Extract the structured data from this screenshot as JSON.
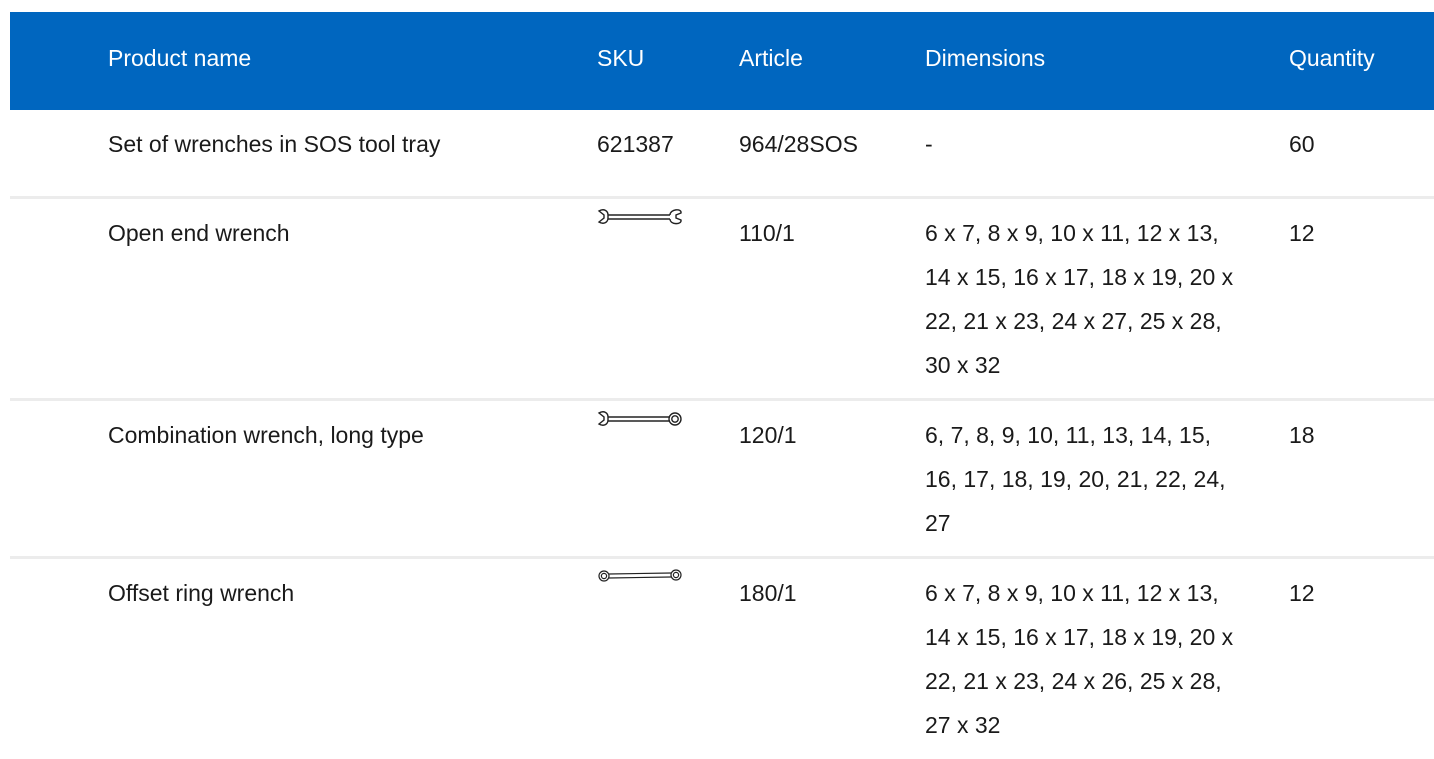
{
  "table": {
    "headers": {
      "name": "Product name",
      "sku": "SKU",
      "article": "Article",
      "dimensions": "Dimensions",
      "quantity": "Quantity"
    },
    "rows": [
      {
        "name": "Set of wrenches in SOS tool tray",
        "sku": "621387",
        "article": "964/28SOS",
        "dimensions": "-",
        "quantity": "60"
      },
      {
        "name": "Open end wrench",
        "sku_icon": "open-end-wrench-icon",
        "article": "110/1",
        "dimensions": "6 x 7, 8 x 9, 10 x 11, 12 x 13, 14 x 15, 16 x 17, 18 x 19, 20 x 22, 21 x 23, 24 x 27, 25 x 28, 30 x 32",
        "quantity": "12"
      },
      {
        "name": "Combination wrench, long type",
        "sku_icon": "combination-wrench-icon",
        "article": "120/1",
        "dimensions": "6, 7, 8, 9, 10, 11, 13, 14, 15, 16, 17, 18, 19, 20, 21, 22, 24, 27",
        "quantity": "18"
      },
      {
        "name": "Offset ring wrench",
        "sku_icon": "offset-ring-wrench-icon",
        "article": "180/1",
        "dimensions": "6 x 7, 8 x 9, 10 x 11, 12 x 13, 14 x 15, 16 x 17, 18 x 19, 20 x 22, 21 x 23, 24 x 26, 25 x 28, 27 x 32",
        "quantity": "12"
      }
    ]
  },
  "colors": {
    "header_bg": "#0066bf",
    "header_text": "#ffffff",
    "row_divider": "#ececec"
  }
}
